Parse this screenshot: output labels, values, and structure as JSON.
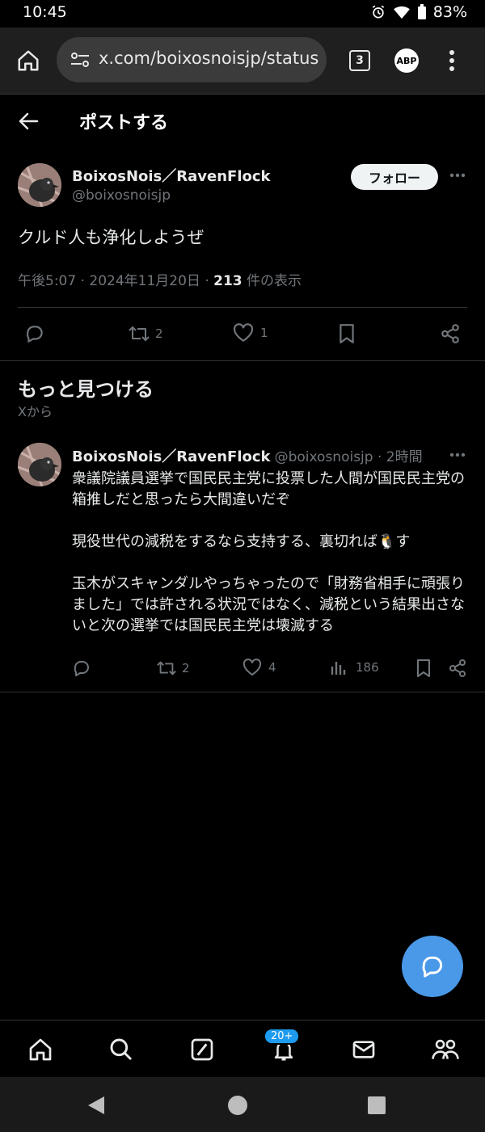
{
  "status_bar": {
    "time": "10:45",
    "battery": "83%"
  },
  "browser": {
    "url": "x.com/boixosnoisjp/status",
    "tab_count": "3",
    "abp_label": "ABP"
  },
  "header": {
    "title": "ポストする"
  },
  "post": {
    "author_name": "BoixosNois／RavenFlock",
    "handle": "@boixosnoisjp",
    "follow_label": "フォロー",
    "text": "クルド人も浄化しようぜ",
    "time": "午後5:07 · 2024年11月20日 · ",
    "views": "213",
    "views_suffix": " 件の表示",
    "retweets": "2",
    "likes": "1"
  },
  "discover": {
    "title": "もっと見つける",
    "subtitle": "Xから"
  },
  "feed_post": {
    "author_name": "BoixosNois／RavenFlock",
    "handle": "@boixosnoisjp",
    "age": " · 2時間",
    "line1": "衆議院議員選挙で国民民主党に投票した人間が国民民主党の箱推しだと思ったら大間違いだぞ",
    "line2": "現役世代の減税をするなら支持する、裏切れば🐧す",
    "line3": "玉木がスキャンダルやっちゃったので「財務省相手に頑張りました」では許される状況ではなく、減税という結果出さないと次の選挙では国民民主党は壊滅する",
    "retweets": "2",
    "likes": "4",
    "views": "186"
  },
  "nav": {
    "notifications_badge": "20+"
  },
  "colors": {
    "accent": "#1d9bf0",
    "fab": "#4a99e9",
    "background": "#000000",
    "secondary_text": "#71767b"
  }
}
